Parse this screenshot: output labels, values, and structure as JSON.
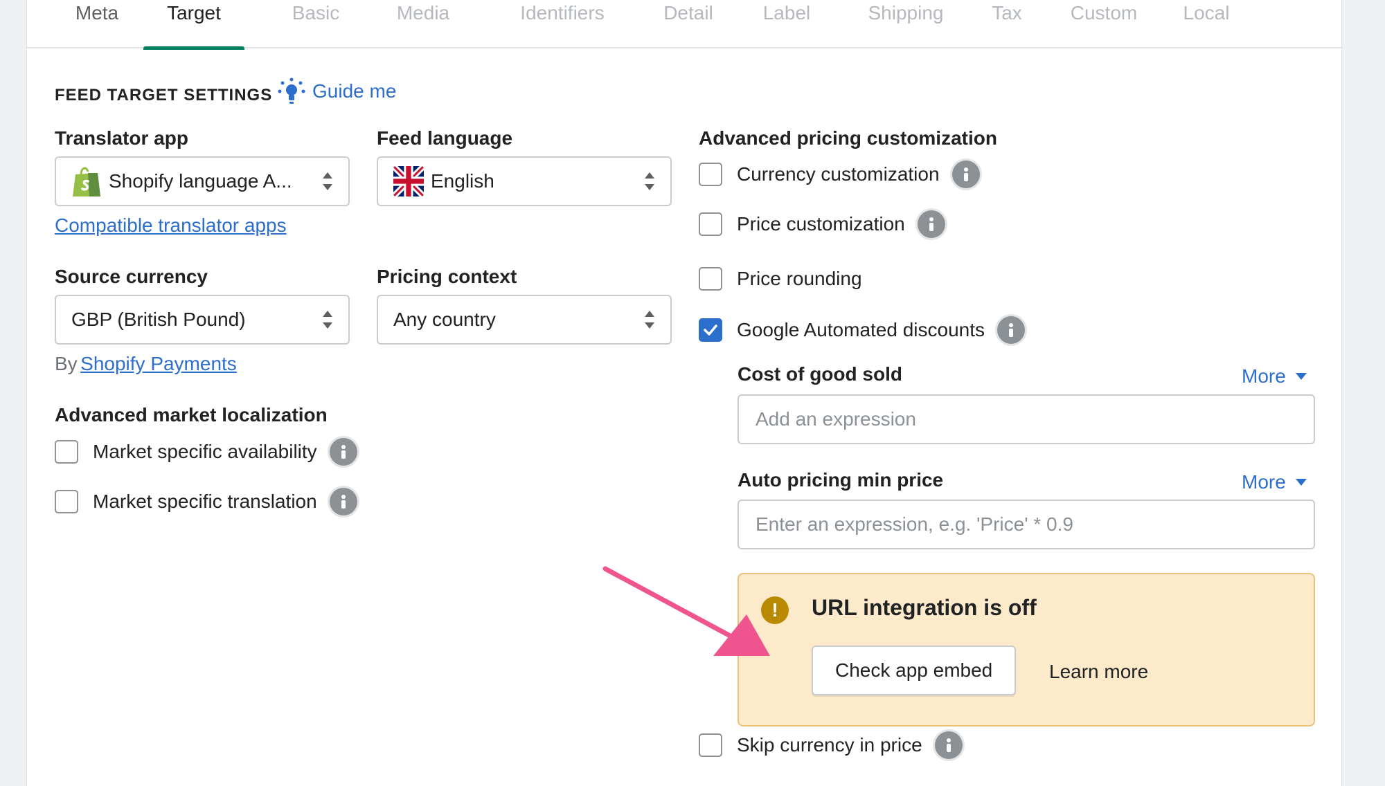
{
  "tabs": [
    "Meta",
    "Target",
    "Basic",
    "Media",
    "Identifiers",
    "Detail",
    "Label",
    "Shipping",
    "Tax",
    "Custom",
    "Local"
  ],
  "section": {
    "title": "FEED TARGET SETTINGS",
    "guide_label": "Guide me"
  },
  "translator": {
    "label": "Translator app",
    "value": "Shopify language A...",
    "link": "Compatible translator apps"
  },
  "feed_language": {
    "label": "Feed language",
    "value": "English"
  },
  "source_currency": {
    "label": "Source currency",
    "value": "GBP (British Pound)",
    "by_prefix": "By",
    "by_link": "Shopify Payments"
  },
  "pricing_context": {
    "label": "Pricing context",
    "value": "Any country"
  },
  "market": {
    "title": "Advanced market localization",
    "availability": "Market specific availability",
    "translation": "Market specific translation"
  },
  "pricing": {
    "title": "Advanced pricing customization",
    "currency": "Currency customization",
    "price": "Price customization",
    "rounding": "Price rounding",
    "google": "Google Automated discounts",
    "google_checked": true
  },
  "cogs": {
    "label": "Cost of good sold",
    "more": "More",
    "placeholder": "Add an expression"
  },
  "autoprice": {
    "label": "Auto pricing min price",
    "more": "More",
    "placeholder": "Enter an expression, e.g. 'Price' * 0.9"
  },
  "banner": {
    "icon": "!",
    "title": "URL integration is off",
    "button": "Check app embed",
    "learn": "Learn more"
  },
  "skip_currency": "Skip currency in price",
  "colors": {
    "accent": "#2c6ecb",
    "tab_active": "#008060",
    "warning_bg": "#fdeacb",
    "warning_icon": "#b98900",
    "arrow": "#f0548f"
  }
}
